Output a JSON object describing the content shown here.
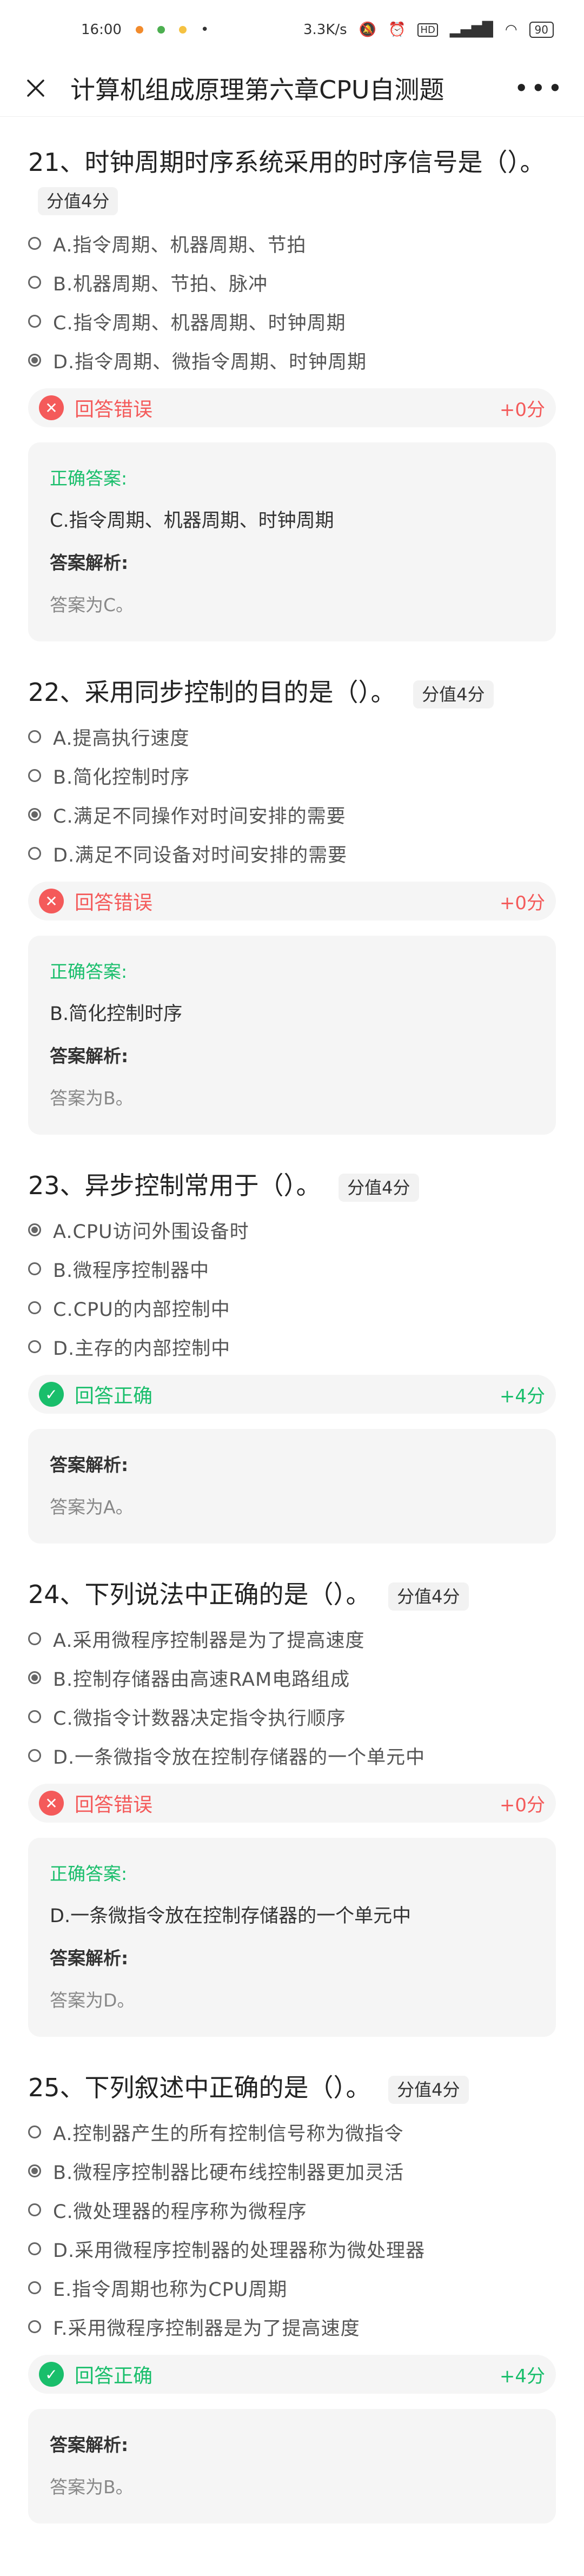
{
  "status_bar": {
    "time": "16:00",
    "speed": "3.3K/s",
    "battery": "90"
  },
  "nav": {
    "title": "计算机组成原理第六章CPU自测题"
  },
  "colors": {
    "correct": "#19be6b",
    "wrong": "#f45a5a"
  },
  "questions": [
    {
      "title": "21、时钟周期时序系统采用的时序信号是（）。",
      "score_tag": "分值4分",
      "options": [
        {
          "text": "A.指令周期、机器周期、节拍",
          "selected": false
        },
        {
          "text": "B.机器周期、节拍、脉冲",
          "selected": false
        },
        {
          "text": "C.指令周期、机器周期、时钟周期",
          "selected": false
        },
        {
          "text": "D.指令周期、微指令周期、时钟周期",
          "selected": true
        }
      ],
      "result": "回答错误",
      "result_score": "+0分",
      "correct_label": "正确答案:",
      "correct_answer": "C.指令周期、机器周期、时钟周期",
      "analysis_label": "答案解析:",
      "analysis": "答案为C。"
    },
    {
      "title": "22、采用同步控制的目的是（）。",
      "score_tag": "分值4分",
      "options": [
        {
          "text": "A.提高执行速度",
          "selected": false
        },
        {
          "text": "B.简化控制时序",
          "selected": false
        },
        {
          "text": "C.满足不同操作对时间安排的需要",
          "selected": true
        },
        {
          "text": "D.满足不同设备对时间安排的需要",
          "selected": false
        }
      ],
      "result": "回答错误",
      "result_score": "+0分",
      "correct_label": "正确答案:",
      "correct_answer": "B.简化控制时序",
      "analysis_label": "答案解析:",
      "analysis": "答案为B。"
    },
    {
      "title": "23、异步控制常用于（）。",
      "score_tag": "分值4分",
      "options": [
        {
          "text": "A.CPU访问外围设备时",
          "selected": true
        },
        {
          "text": "B.微程序控制器中",
          "selected": false
        },
        {
          "text": "C.CPU的内部控制中",
          "selected": false
        },
        {
          "text": "D.主存的内部控制中",
          "selected": false
        }
      ],
      "result": "回答正确",
      "result_score": "+4分",
      "analysis_label": "答案解析:",
      "analysis": "答案为A。"
    },
    {
      "title": "24、下列说法中正确的是（）。",
      "score_tag": "分值4分",
      "options": [
        {
          "text": "A.采用微程序控制器是为了提高速度",
          "selected": false
        },
        {
          "text": "B.控制存储器由高速RAM电路组成",
          "selected": true
        },
        {
          "text": "C.微指令计数器决定指令执行顺序",
          "selected": false
        },
        {
          "text": "D.一条微指令放在控制存储器的一个单元中",
          "selected": false
        }
      ],
      "result": "回答错误",
      "result_score": "+0分",
      "correct_label": "正确答案:",
      "correct_answer": "D.一条微指令放在控制存储器的一个单元中",
      "analysis_label": "答案解析:",
      "analysis": "答案为D。"
    },
    {
      "title": "25、下列叙述中正确的是（）。",
      "score_tag": "分值4分",
      "options": [
        {
          "text": "A.控制器产生的所有控制信号称为微指令",
          "selected": false
        },
        {
          "text": "B.微程序控制器比硬布线控制器更加灵活",
          "selected": true
        },
        {
          "text": "C.微处理器的程序称为微程序",
          "selected": false
        },
        {
          "text": "D.采用微程序控制器的处理器称为微处理器",
          "selected": false
        },
        {
          "text": "E.指令周期也称为CPU周期",
          "selected": false
        },
        {
          "text": "F.采用微程序控制器是为了提高速度",
          "selected": false
        }
      ],
      "result": "回答正确",
      "result_score": "+4分",
      "analysis_label": "答案解析:",
      "analysis": "答案为B。"
    }
  ]
}
